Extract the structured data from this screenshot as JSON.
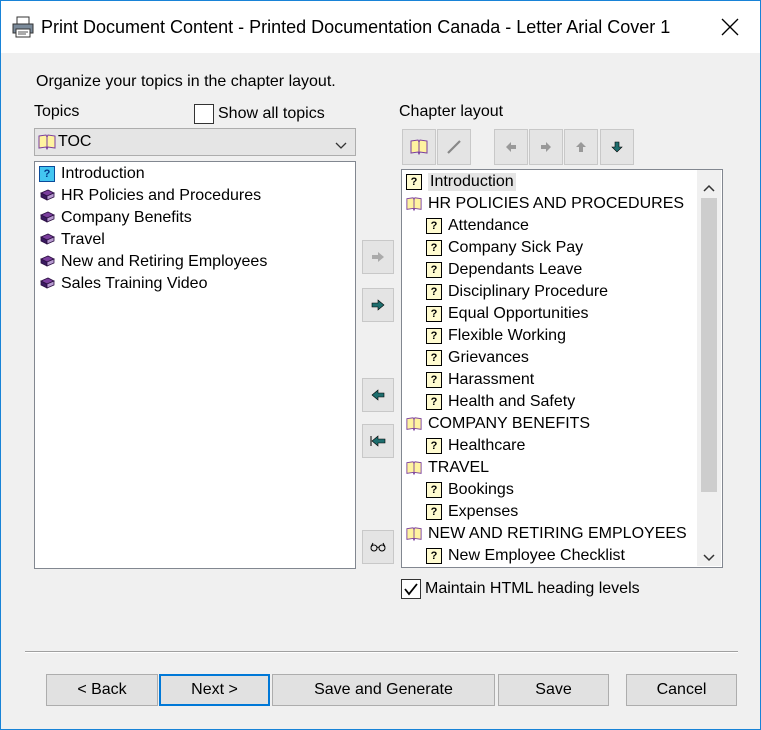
{
  "window": {
    "title": "Print Document Content - Printed Documentation Canada - Letter Arial Cover 1"
  },
  "instruction": "Organize your topics in the chapter layout.",
  "topics": {
    "label": "Topics",
    "show_all_label": "Show all topics",
    "show_all_checked": false,
    "dropdown_value": "TOC",
    "items": [
      {
        "label": "Introduction",
        "icon": "topic-icon"
      },
      {
        "label": "HR Policies and Procedures",
        "icon": "book-icon"
      },
      {
        "label": "Company Benefits",
        "icon": "book-icon"
      },
      {
        "label": "Travel",
        "icon": "book-icon"
      },
      {
        "label": "New and Retiring Employees",
        "icon": "book-icon"
      },
      {
        "label": "Sales Training Video",
        "icon": "book-icon"
      }
    ]
  },
  "chapter": {
    "label": "Chapter layout",
    "items": [
      {
        "label": "Introduction",
        "icon": "topic-icon",
        "indent": 0
      },
      {
        "label": "HR POLICIES AND PROCEDURES",
        "icon": "book-open-icon",
        "indent": 0
      },
      {
        "label": "Attendance",
        "icon": "topic-icon",
        "indent": 1
      },
      {
        "label": "Company Sick Pay",
        "icon": "topic-icon",
        "indent": 1
      },
      {
        "label": "Dependants Leave",
        "icon": "topic-icon",
        "indent": 1
      },
      {
        "label": "Disciplinary Procedure",
        "icon": "topic-icon",
        "indent": 1
      },
      {
        "label": "Equal Opportunities",
        "icon": "topic-icon",
        "indent": 1
      },
      {
        "label": "Flexible Working",
        "icon": "topic-icon",
        "indent": 1
      },
      {
        "label": "Grievances",
        "icon": "topic-icon",
        "indent": 1
      },
      {
        "label": "Harassment",
        "icon": "topic-icon",
        "indent": 1
      },
      {
        "label": "Health and Safety",
        "icon": "topic-icon",
        "indent": 1
      },
      {
        "label": "COMPANY BENEFITS",
        "icon": "book-open-icon",
        "indent": 0
      },
      {
        "label": "Healthcare",
        "icon": "topic-icon",
        "indent": 1
      },
      {
        "label": "TRAVEL",
        "icon": "book-open-icon",
        "indent": 0
      },
      {
        "label": "Bookings",
        "icon": "topic-icon",
        "indent": 1
      },
      {
        "label": "Expenses",
        "icon": "topic-icon",
        "indent": 1
      },
      {
        "label": "NEW AND RETIRING EMPLOYEES",
        "icon": "book-open-icon",
        "indent": 0
      },
      {
        "label": "New Employee Checklist",
        "icon": "topic-icon",
        "indent": 1
      }
    ],
    "maintain_heading_label": "Maintain HTML heading levels",
    "maintain_heading_checked": true
  },
  "buttons": {
    "back": "< Back",
    "next": "Next >",
    "save_generate": "Save and Generate",
    "save": "Save",
    "cancel": "Cancel"
  },
  "colors": {
    "accent": "#0078d7",
    "book": "#7a3e9d",
    "teal_arrow": "#1e6e6e"
  }
}
